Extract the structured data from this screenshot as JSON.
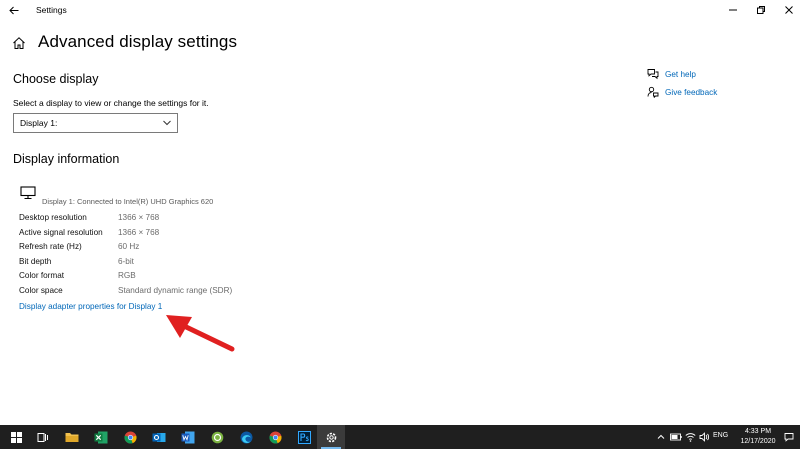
{
  "window": {
    "title": "Settings"
  },
  "header": {
    "page_title": "Advanced display settings"
  },
  "choose_display": {
    "title": "Choose display",
    "helper": "Select a display to view or change the settings for it.",
    "selected": "Display 1:"
  },
  "display_info": {
    "title": "Display information",
    "connected": "Display 1: Connected to Intel(R) UHD Graphics 620",
    "rows": [
      {
        "label": "Desktop resolution",
        "value": "1366 × 768"
      },
      {
        "label": "Active signal resolution",
        "value": "1366 × 768"
      },
      {
        "label": "Refresh rate (Hz)",
        "value": "60 Hz"
      },
      {
        "label": "Bit depth",
        "value": "6-bit"
      },
      {
        "label": "Color format",
        "value": "RGB"
      },
      {
        "label": "Color space",
        "value": "Standard dynamic range (SDR)"
      }
    ],
    "adapter_link": "Display adapter properties for Display 1"
  },
  "side_links": {
    "help": "Get help",
    "feedback": "Give feedback"
  },
  "taskbar": {
    "apps": [
      "start-icon",
      "task-view-icon",
      "file-explorer-icon",
      "excel-icon",
      "chrome-icon",
      "outlook-icon",
      "word-icon",
      "app-icon",
      "edge-icon",
      "chrome-icon",
      "photoshop-icon",
      "settings-icon"
    ],
    "language": "ENG",
    "time": "4:33 PM",
    "date": "12/17/2020"
  },
  "colors": {
    "accent": "#0067b8",
    "taskbar": "#1f1f1f",
    "annotation_arrow": "#e02020"
  }
}
